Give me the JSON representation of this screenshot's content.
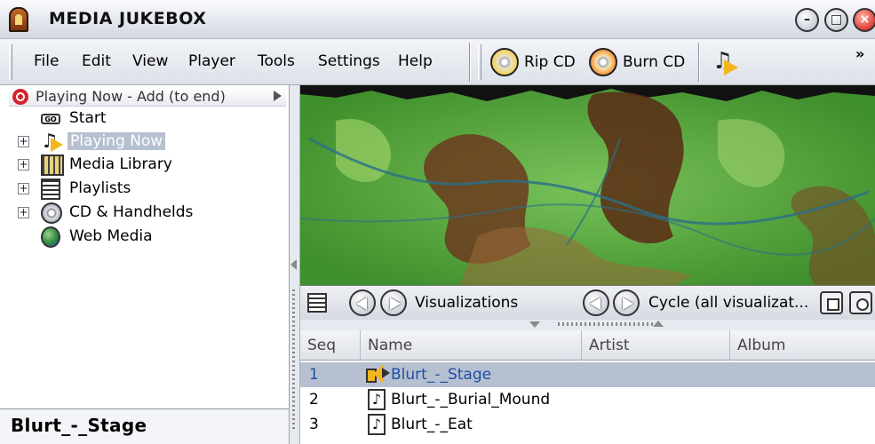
{
  "window": {
    "title": "MEDIA JUKEBOX",
    "min_glyph": "–",
    "max_glyph": "□",
    "close_glyph": "×"
  },
  "menu": [
    "File",
    "Edit",
    "View",
    "Player",
    "Tools",
    "Settings",
    "Help"
  ],
  "toolbar": {
    "rip_label": "Rip CD",
    "burn_label": "Burn CD",
    "more_glyph": "»",
    "note_glyph": "♫"
  },
  "tree": {
    "header": "Playing Now - Add (to end)",
    "items": [
      {
        "label": "Start",
        "icon": "go-icon",
        "expandable": false,
        "selected": false
      },
      {
        "label": "Playing Now",
        "icon": "playing-now-icon",
        "expandable": true,
        "selected": true
      },
      {
        "label": "Media Library",
        "icon": "media-library-icon",
        "expandable": true,
        "selected": false
      },
      {
        "label": "Playlists",
        "icon": "playlists-icon",
        "expandable": true,
        "selected": false
      },
      {
        "label": "CD & Handhelds",
        "icon": "cd-icon",
        "expandable": true,
        "selected": false
      },
      {
        "label": "Web Media",
        "icon": "web-media-icon",
        "expandable": false,
        "selected": false
      }
    ],
    "go_text": "GO",
    "expander_glyph": "+"
  },
  "now_playing": "Blurt_-_Stage",
  "viz_bar": {
    "visualizations_label": "Visualizations",
    "cycle_label": "Cycle (all visualizat..."
  },
  "tracks": {
    "columns": [
      "Seq",
      "Name",
      "Artist",
      "Album"
    ],
    "rows": [
      {
        "seq": "1",
        "name": "Blurt_-_Stage",
        "playing": true
      },
      {
        "seq": "2",
        "name": "Blurt_-_Burial_Mound",
        "playing": false
      },
      {
        "seq": "3",
        "name": "Blurt_-_Eat",
        "playing": false
      }
    ],
    "note_glyph": "♪"
  },
  "colors": {
    "selection": "#b6c0d0",
    "playing_text": "#1f4fa8",
    "accent_orange": "#f3b61f"
  }
}
